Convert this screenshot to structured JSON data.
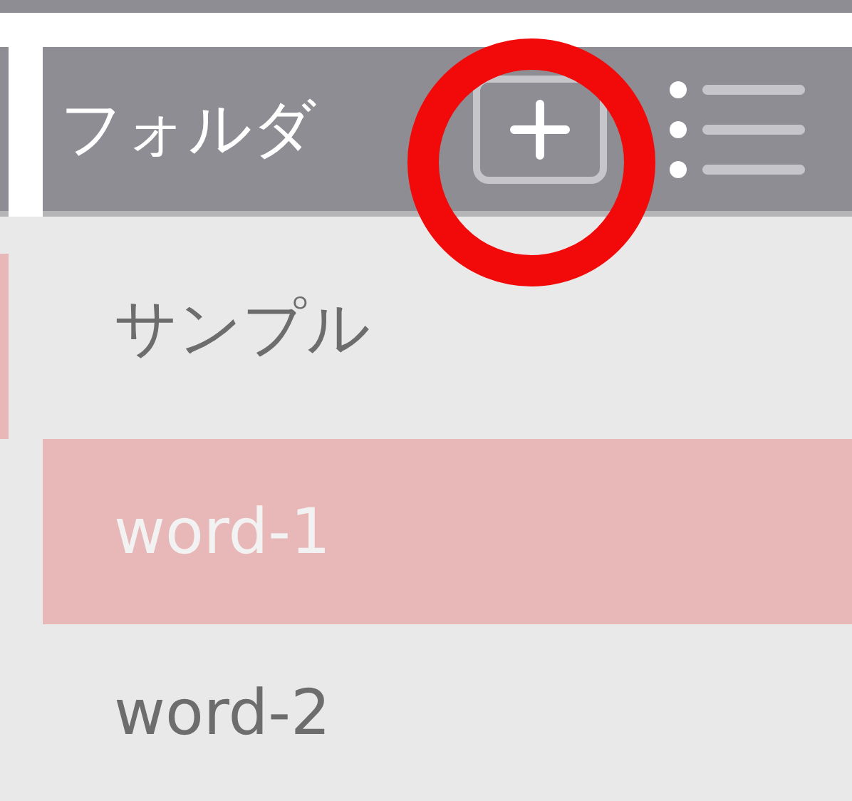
{
  "header": {
    "title": "フォルダ"
  },
  "folders": [
    {
      "label": "サンプル",
      "selected": false
    },
    {
      "label": "word-1",
      "selected": true
    },
    {
      "label": "word-2",
      "selected": false
    }
  ]
}
